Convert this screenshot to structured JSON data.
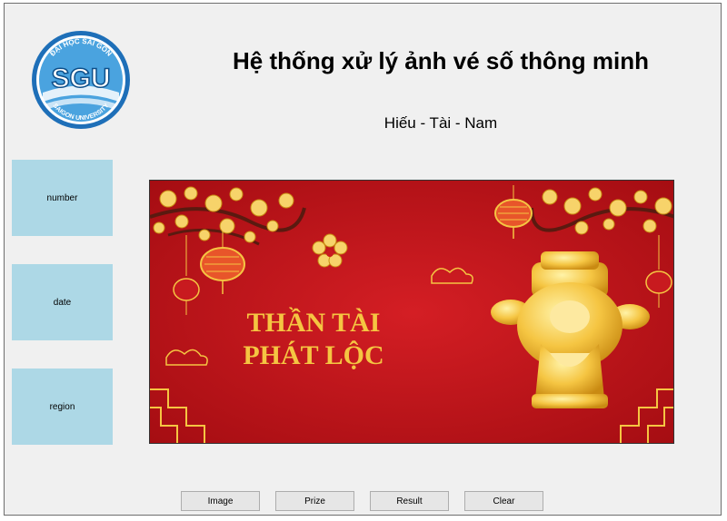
{
  "header": {
    "title": "Hệ thống xử lý ảnh vé số thông minh",
    "subtitle": "Hiếu - Tài - Nam"
  },
  "logo": {
    "abbr": "SGU",
    "top_text": "ĐẠI HỌC SÀI GÒN",
    "bottom_text": "SAIGON UNIVERSITY"
  },
  "fields": {
    "number": "number",
    "date": "date",
    "region": "region"
  },
  "banner": {
    "line1": "THẦN TÀI",
    "line2": "PHÁT LỘC"
  },
  "buttons": {
    "image": "Image",
    "prize": "Prize",
    "result": "Result",
    "clear": "Clear"
  },
  "colors": {
    "field_bg": "#add8e6",
    "banner_red": "#c8151b",
    "gold": "#f5c542",
    "window_bg": "#f0f0f0"
  }
}
